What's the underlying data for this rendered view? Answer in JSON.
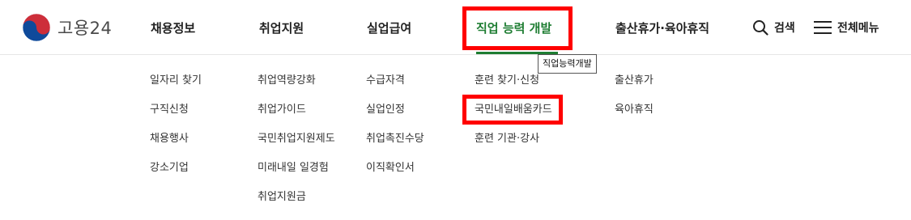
{
  "logo": {
    "text": "고용24"
  },
  "gnb": [
    {
      "label": "채용정보"
    },
    {
      "label": "취업지원"
    },
    {
      "label": "실업급여"
    },
    {
      "label": "직업 능력 개발"
    },
    {
      "label": "출산휴가·육아휴직"
    }
  ],
  "utility": {
    "search_label": "검색",
    "menu_label": "전체메뉴"
  },
  "tooltip": "직업능력개발",
  "submenus": [
    [
      "일자리 찾기",
      "구직신청",
      "채용행사",
      "강소기업"
    ],
    [
      "취업역량강화",
      "취업가이드",
      "국민취업지원제도",
      "미래내일 일경험",
      "취업지원금"
    ],
    [
      "수급자격",
      "실업인정",
      "취업촉진수당",
      "이직확인서"
    ],
    [
      "훈련 찾기·신청",
      "국민내일배움카드",
      "훈련 기관·강사"
    ],
    [
      "출산휴가",
      "육아휴직"
    ]
  ],
  "colors": {
    "active_green": "#1e7d32",
    "highlight_red": "#ff0000",
    "emblem_red": "#cd2e3a",
    "emblem_blue": "#0f4a9b"
  }
}
